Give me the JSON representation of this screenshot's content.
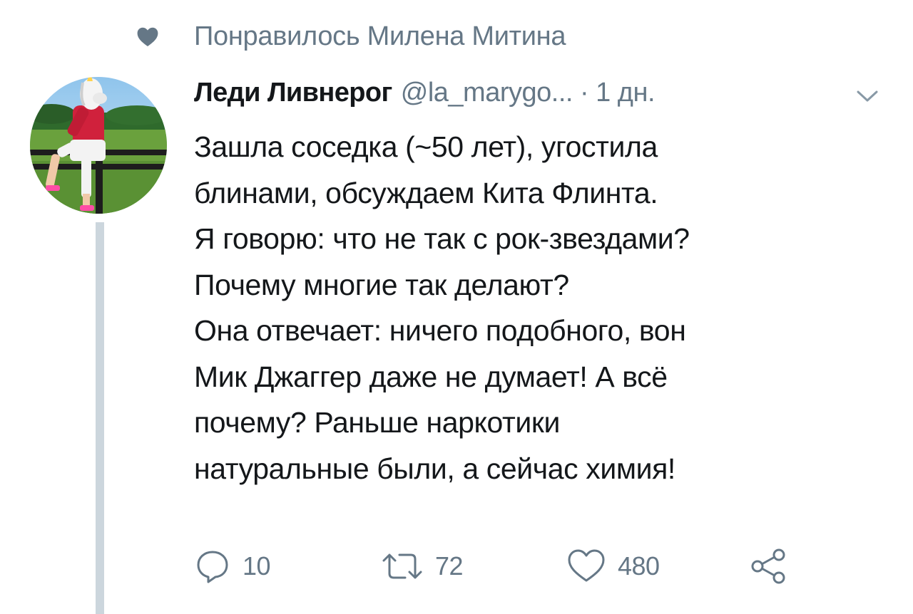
{
  "social_context": {
    "icon": "heart-icon",
    "text": "Понравилось Милена Митина"
  },
  "tweet": {
    "author": {
      "name": "Леди Ливнерог",
      "handle": "@la_marygo...",
      "avatar": "avatar-unicorn-mask-person"
    },
    "separator": "·",
    "time": "1 дн.",
    "text_lines": [
      "Зашла соседка (~50 лет), угостила",
      "блинами, обсуждаем Кита Флинта.",
      "Я говорю: что не так с рок-звездами?",
      "Почему многие так делают?",
      "Она отвечает: ничего подобного, вон",
      "Мик Джаггер даже не думает! А всё",
      "почему? Раньше наркотики",
      "натуральные были, а сейчас химия!"
    ],
    "actions": {
      "reply": {
        "icon": "reply-icon",
        "count": "10"
      },
      "retweet": {
        "icon": "retweet-icon",
        "count": "72"
      },
      "like": {
        "icon": "heart-outline-icon",
        "count": "480"
      },
      "share": {
        "icon": "share-icon"
      }
    }
  },
  "colors": {
    "text": "#14171a",
    "secondary": "#657786",
    "thread_line": "#ccd6dd"
  }
}
